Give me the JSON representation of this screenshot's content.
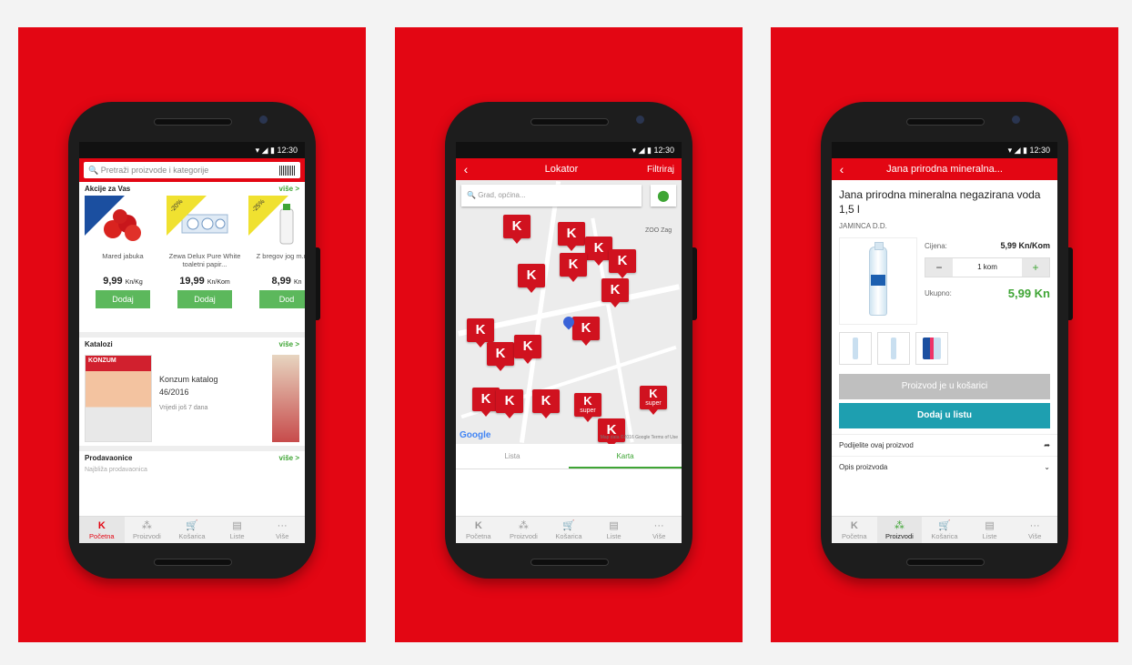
{
  "status": {
    "time": "12:30"
  },
  "home": {
    "search_placeholder": "Pretraži proizvode i kategorije",
    "deals_title": "Akcije za Vas",
    "more": "više >",
    "products": [
      {
        "name": "Mared jabuka",
        "price": "9,99",
        "unit": "Kn/Kg",
        "button": "Dodaj"
      },
      {
        "name": "Zewa Delux Pure White toaletni papir...",
        "price": "19,99",
        "unit": "Kn/Kom",
        "button": "Dodaj",
        "badge": "-20%"
      },
      {
        "name": "Z bregov jog m.m. 1",
        "price": "8,99",
        "unit": "Kn",
        "button": "Dod",
        "badge": "-25%"
      }
    ],
    "catalogs_title": "Katalozi",
    "catalog_cover": "KONZUM",
    "catalog_name": "Konzum katalog",
    "catalog_issue": "46/2016",
    "catalog_valid": "Vrijedi još 7 dana",
    "stores_title": "Prodavaonice",
    "nearest_hint": "Najbliža prodavaonica"
  },
  "nav": [
    "Početna",
    "Proizvodi",
    "Košarica",
    "Liste",
    "Više"
  ],
  "locator": {
    "title": "Lokator",
    "filter": "Filtriraj",
    "search_placeholder": "Grad, općina...",
    "zoo_label": "ZOO Zag",
    "pin_letter": "K",
    "super_label": "super",
    "google": "Google",
    "attribution": "Map data ©2016 Google   Terms of Use",
    "tab_list": "Lista",
    "tab_map": "Karta"
  },
  "product": {
    "appbar_title": "Jana prirodna mineralna...",
    "name": "Jana prirodna mineralna negazirana voda 1,5 l",
    "maker": "JAMINCA D.D.",
    "price_label": "Cijena:",
    "price_value": "5,99 Kn/Kom",
    "qty": "1 kom",
    "total_label": "Ukupno:",
    "total_value": "5,99 Kn",
    "in_cart_button": "Proizvod je u košarici",
    "add_list_button": "Dodaj u listu",
    "share_label": "Podijelite ovaj proizvod",
    "description_label": "Opis proizvoda"
  },
  "colors": {
    "brand_red": "#e30613",
    "accent_green": "#3fa535",
    "teal": "#1e9fb0"
  }
}
